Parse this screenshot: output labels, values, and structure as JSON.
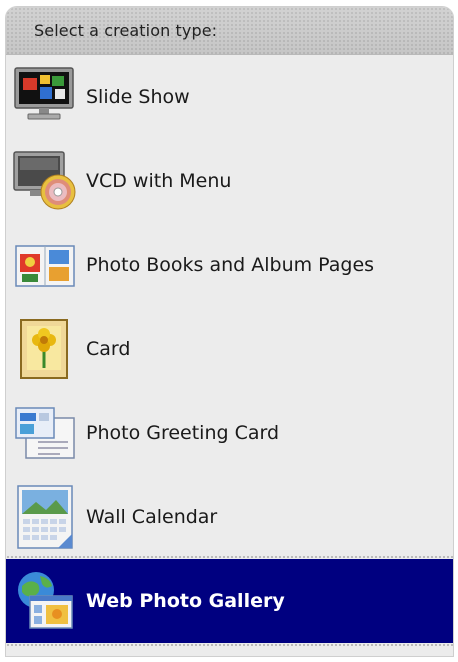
{
  "header": {
    "title": "Select a creation type:"
  },
  "items": [
    {
      "label": "Slide Show",
      "icon": "slide-show-icon"
    },
    {
      "label": "VCD with Menu",
      "icon": "vcd-disc-icon"
    },
    {
      "label": "Photo Books and Album Pages",
      "icon": "photo-book-icon"
    },
    {
      "label": "Card",
      "icon": "card-icon"
    },
    {
      "label": "Photo Greeting Card",
      "icon": "greeting-card-icon"
    },
    {
      "label": "Wall Calendar",
      "icon": "calendar-icon"
    },
    {
      "label": "Web Photo Gallery",
      "icon": "web-gallery-icon"
    }
  ],
  "selected_index": 6,
  "colors": {
    "selection": "#000080",
    "panel_bg": "#ececec",
    "header_bg": "#c8c8c8"
  }
}
